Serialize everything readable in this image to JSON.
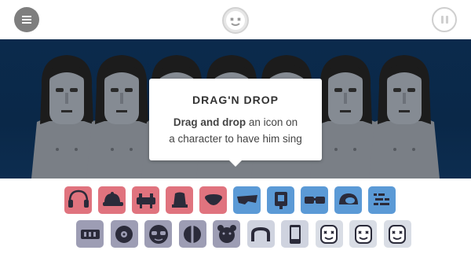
{
  "header": {
    "menu_icon": "hamburger-icon",
    "logo_icon": "marshmello-head-icon",
    "pause_icon": "pause-icon"
  },
  "tooltip": {
    "title": "DRAG'N DROP",
    "message_bold": "Drag and drop",
    "message_rest_1": " an icon on",
    "message_line_2": "a character to have him sing"
  },
  "characters_count": 7,
  "icon_tray": {
    "row1": [
      {
        "name": "headphones-icon",
        "color": "red"
      },
      {
        "name": "cap-icon",
        "color": "red"
      },
      {
        "name": "dj-deck-icon",
        "color": "red"
      },
      {
        "name": "hat-side-icon",
        "color": "red"
      },
      {
        "name": "bowl-icon",
        "color": "red"
      },
      {
        "name": "wedge-shades-icon",
        "color": "blue"
      },
      {
        "name": "pendant-icon",
        "color": "blue"
      },
      {
        "name": "goggles-icon",
        "color": "blue"
      },
      {
        "name": "helmet-icon",
        "color": "blue"
      },
      {
        "name": "dots-pattern-icon",
        "color": "blue"
      }
    ],
    "row2": [
      {
        "name": "mixer-icon",
        "color": "gray"
      },
      {
        "name": "disc-icon",
        "color": "gray"
      },
      {
        "name": "round-shades-icon",
        "color": "gray"
      },
      {
        "name": "ball-icon",
        "color": "gray"
      },
      {
        "name": "bear-head-icon",
        "color": "gray"
      },
      {
        "name": "arch-icon",
        "color": "light"
      },
      {
        "name": "phone-icon",
        "color": "light"
      },
      {
        "name": "marshmello-1-icon",
        "color": "ice"
      },
      {
        "name": "marshmello-2-icon",
        "color": "ice"
      },
      {
        "name": "marshmello-3-icon",
        "color": "ice"
      }
    ]
  },
  "colors": {
    "red": "#e0737e",
    "blue": "#5b9ad6",
    "gray": "#9d9db4",
    "light": "#cfd3df",
    "ice": "#d9dde5",
    "stage_background": "#0b2a4c"
  }
}
